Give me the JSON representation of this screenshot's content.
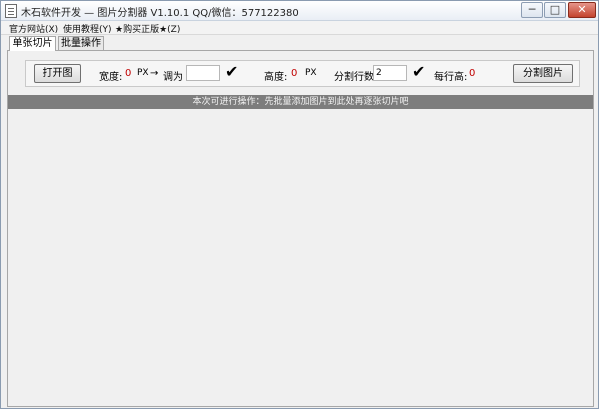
{
  "window": {
    "title": "木石软件开发 — 图片分割器 V1.10.1    QQ/微信：577122380",
    "controls": {
      "minimize": "─",
      "maximize": "□",
      "close": "✕"
    }
  },
  "menu": {
    "items": [
      "官方网站(X)",
      "使用教程(Y)",
      "★购买正版★(Z)"
    ]
  },
  "tabs": {
    "single": "单张切片",
    "batch": "批量操作"
  },
  "toolbar": {
    "open_button": "打开图",
    "width_label": "宽度:",
    "width_value": "0",
    "unit_px_1": "PX",
    "arrow": "→",
    "resize_label": "调为",
    "resize_value": "",
    "check_icon": "✔",
    "height_label": "高度:",
    "height_value": "0",
    "unit_px_2": "PX",
    "rows_label": "分割行数:",
    "rows_value": "2",
    "row_height_label": "每行高:",
    "row_height_value": "0",
    "split_button": "分割图片"
  },
  "hint": "本次可进行操作：先批量添加图片到此处再逐张切片吧"
}
